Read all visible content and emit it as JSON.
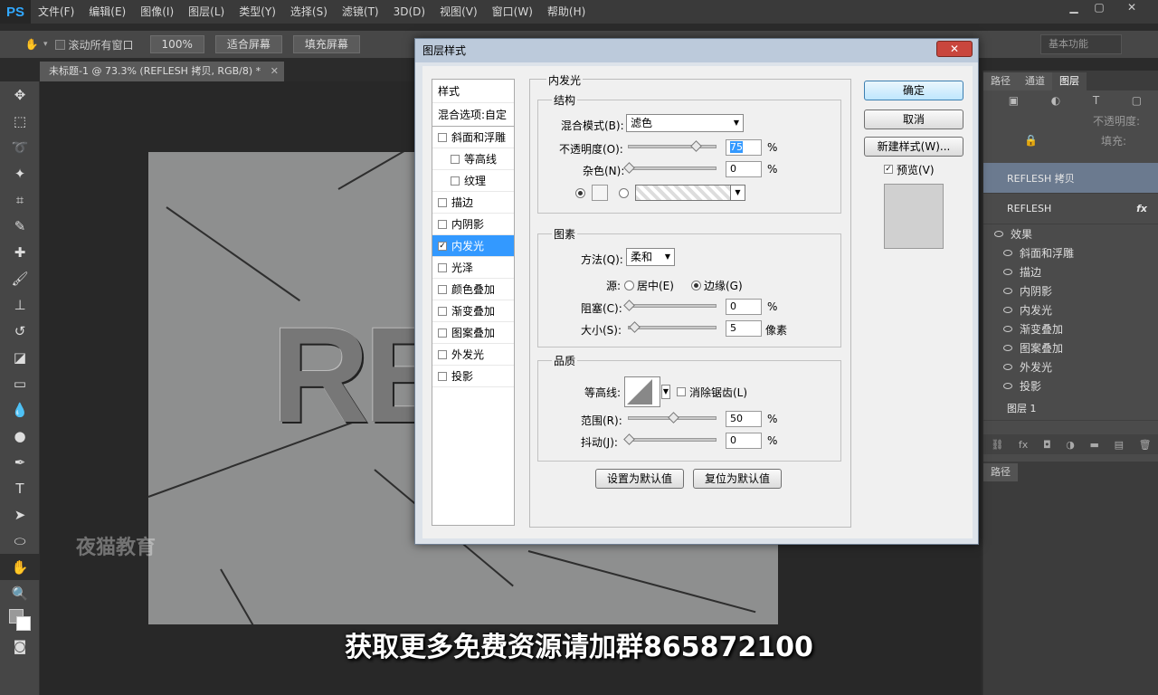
{
  "app": {
    "logo": "PS"
  },
  "menu": [
    "文件(F)",
    "编辑(E)",
    "图像(I)",
    "图层(L)",
    "类型(Y)",
    "选择(S)",
    "滤镜(T)",
    "3D(D)",
    "视图(V)",
    "窗口(W)",
    "帮助(H)"
  ],
  "options_bar": {
    "scroll_all": "滚动所有窗口",
    "zoom_btn": "100%",
    "fit_btn": "适合屏幕",
    "fill_btn": "填充屏幕",
    "workspace": "基本功能"
  },
  "document": {
    "tab_title": "未标题-1 @ 73.3% (REFLESH 拷贝, RGB/8) *",
    "canvas_text": "REFL",
    "watermark": "夜猫教育"
  },
  "layers_panel": {
    "tabs": [
      "路径",
      "通道",
      "图层"
    ],
    "opacity_label": "不透明度:",
    "fill_label": "填充:",
    "layers": [
      {
        "name": "REFLESH 拷贝",
        "selected": true
      },
      {
        "name": "REFLESH",
        "fx": "fx"
      }
    ],
    "effects_label": "效果",
    "effects": [
      "斜面和浮雕",
      "描边",
      "内阴影",
      "内发光",
      "渐变叠加",
      "图案叠加",
      "外发光",
      "投影"
    ],
    "bottom_layer": "图层 1",
    "lower_tab": "路径"
  },
  "dialog": {
    "title": "图层样式",
    "close": "✕",
    "styles_header": "样式",
    "blend_options": "混合选项:自定",
    "style_items": [
      {
        "label": "斜面和浮雕",
        "checked": false,
        "indent": false
      },
      {
        "label": "等高线",
        "checked": false,
        "indent": true
      },
      {
        "label": "纹理",
        "checked": false,
        "indent": true
      },
      {
        "label": "描边",
        "checked": false,
        "indent": false
      },
      {
        "label": "内阴影",
        "checked": false,
        "indent": false
      },
      {
        "label": "内发光",
        "checked": true,
        "indent": false,
        "selected": true
      },
      {
        "label": "光泽",
        "checked": false,
        "indent": false
      },
      {
        "label": "颜色叠加",
        "checked": false,
        "indent": false
      },
      {
        "label": "渐变叠加",
        "checked": false,
        "indent": false
      },
      {
        "label": "图案叠加",
        "checked": false,
        "indent": false
      },
      {
        "label": "外发光",
        "checked": false,
        "indent": false
      },
      {
        "label": "投影",
        "checked": false,
        "indent": false
      }
    ],
    "section_title": "内发光",
    "structure": {
      "title": "结构",
      "blend_mode_label": "混合模式(B):",
      "blend_mode_value": "滤色",
      "opacity_label": "不透明度(O):",
      "opacity_value": "75",
      "opacity_pct": 0.75,
      "noise_label": "杂色(N):",
      "noise_value": "0",
      "pct": "%"
    },
    "elements": {
      "title": "图素",
      "technique_label": "方法(Q):",
      "technique_value": "柔和",
      "source_label": "源:",
      "source_center": "居中(E)",
      "source_edge": "边缘(G)",
      "choke_label": "阻塞(C):",
      "choke_value": "0",
      "size_label": "大小(S):",
      "size_value": "5",
      "size_unit": "像素"
    },
    "quality": {
      "title": "品质",
      "contour_label": "等高线:",
      "antialias_label": "消除锯齿(L)",
      "range_label": "范围(R):",
      "range_value": "50",
      "jitter_label": "抖动(J):",
      "jitter_value": "0"
    },
    "make_default": "设置为默认值",
    "reset_default": "复位为默认值",
    "ok": "确定",
    "cancel": "取消",
    "new_style": "新建样式(W)...",
    "preview_label": "预览(V)"
  },
  "subtitle": "获取更多免费资源请加群865872100"
}
